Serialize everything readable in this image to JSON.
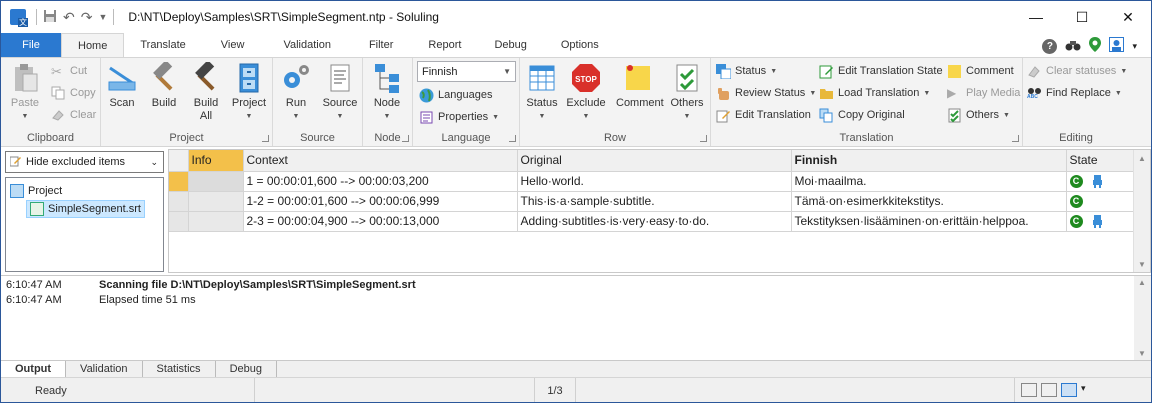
{
  "window": {
    "title": "D:\\NT\\Deploy\\Samples\\SRT\\SimpleSegment.ntp  -  Soluling",
    "minimize": "—",
    "maximize": "☐",
    "close": "✕"
  },
  "ribbon_tabs": [
    "File",
    "Home",
    "Translate",
    "View",
    "Validation",
    "Filter",
    "Report",
    "Debug",
    "Options"
  ],
  "groups": {
    "clipboard": {
      "label": "Clipboard",
      "paste": "Paste",
      "cut": "Cut",
      "copy": "Copy",
      "clear": "Clear"
    },
    "project": {
      "label": "Project",
      "scan": "Scan",
      "build": "Build",
      "build_all": "Build All",
      "project": "Project"
    },
    "source": {
      "label": "Source",
      "run": "Run",
      "source": "Source"
    },
    "node": {
      "label": "Node",
      "node": "Node"
    },
    "language": {
      "label": "Language",
      "selected": "Finnish",
      "languages": "Languages",
      "properties": "Properties"
    },
    "row": {
      "label": "Row",
      "status": "Status",
      "exclude": "Exclude",
      "comment": "Comment",
      "others": "Others"
    },
    "translation": {
      "label": "Translation",
      "status": "Status",
      "review_status": "Review Status",
      "edit_translation": "Edit Translation",
      "edit_translation_state": "Edit Translation State",
      "load_translation": "Load Translation",
      "copy_original": "Copy Original",
      "comment": "Comment",
      "play_media": "Play Media",
      "others": "Others"
    },
    "editing": {
      "label": "Editing",
      "clear_statuses": "Clear statuses",
      "find_replace": "Find  Replace",
      "abc": "ABC"
    }
  },
  "icons": {
    "exclude_stop": "STOP"
  },
  "filter": {
    "value": "Hide excluded items"
  },
  "tree": {
    "root": "Project",
    "child": "SimpleSegment.srt"
  },
  "grid": {
    "columns": [
      "Info",
      "Context",
      "Original",
      "Finnish",
      "State"
    ],
    "rows": [
      {
        "context": "1 = 00:00:01,600 --> 00:00:03,200",
        "original": "Hello·world.",
        "translation": "Moi·maailma.",
        "state": "C",
        "robot": true
      },
      {
        "context": "1-2 = 00:00:01,600 --> 00:00:06,999",
        "original": "This·is·a·sample·subtitle.",
        "translation": "Tämä·on·esimerkkitekstitys.",
        "state": "C",
        "robot": false
      },
      {
        "context": "2-3 = 00:00:04,900 --> 00:00:13,000",
        "original": "Adding·subtitles·is·very·easy·to·do.",
        "translation": "Tekstityksen·lisääminen·on·erittäin·helppoa.",
        "state": "C",
        "robot": true
      }
    ]
  },
  "output_log": [
    {
      "time": "6:10:47 AM",
      "message": "Scanning file D:\\NT\\Deploy\\Samples\\SRT\\SimpleSegment.srt",
      "bold": true
    },
    {
      "time": "6:10:47 AM",
      "message": "Elapsed time 51 ms",
      "bold": false
    }
  ],
  "bottom_tabs": [
    "Output",
    "Validation",
    "Statistics",
    "Debug"
  ],
  "status_bar": {
    "state": "Ready",
    "position": "1/3"
  },
  "colors": {
    "accent": "#2b79d0",
    "info_header": "#f3c04a",
    "state_green": "#1e8a1e"
  }
}
